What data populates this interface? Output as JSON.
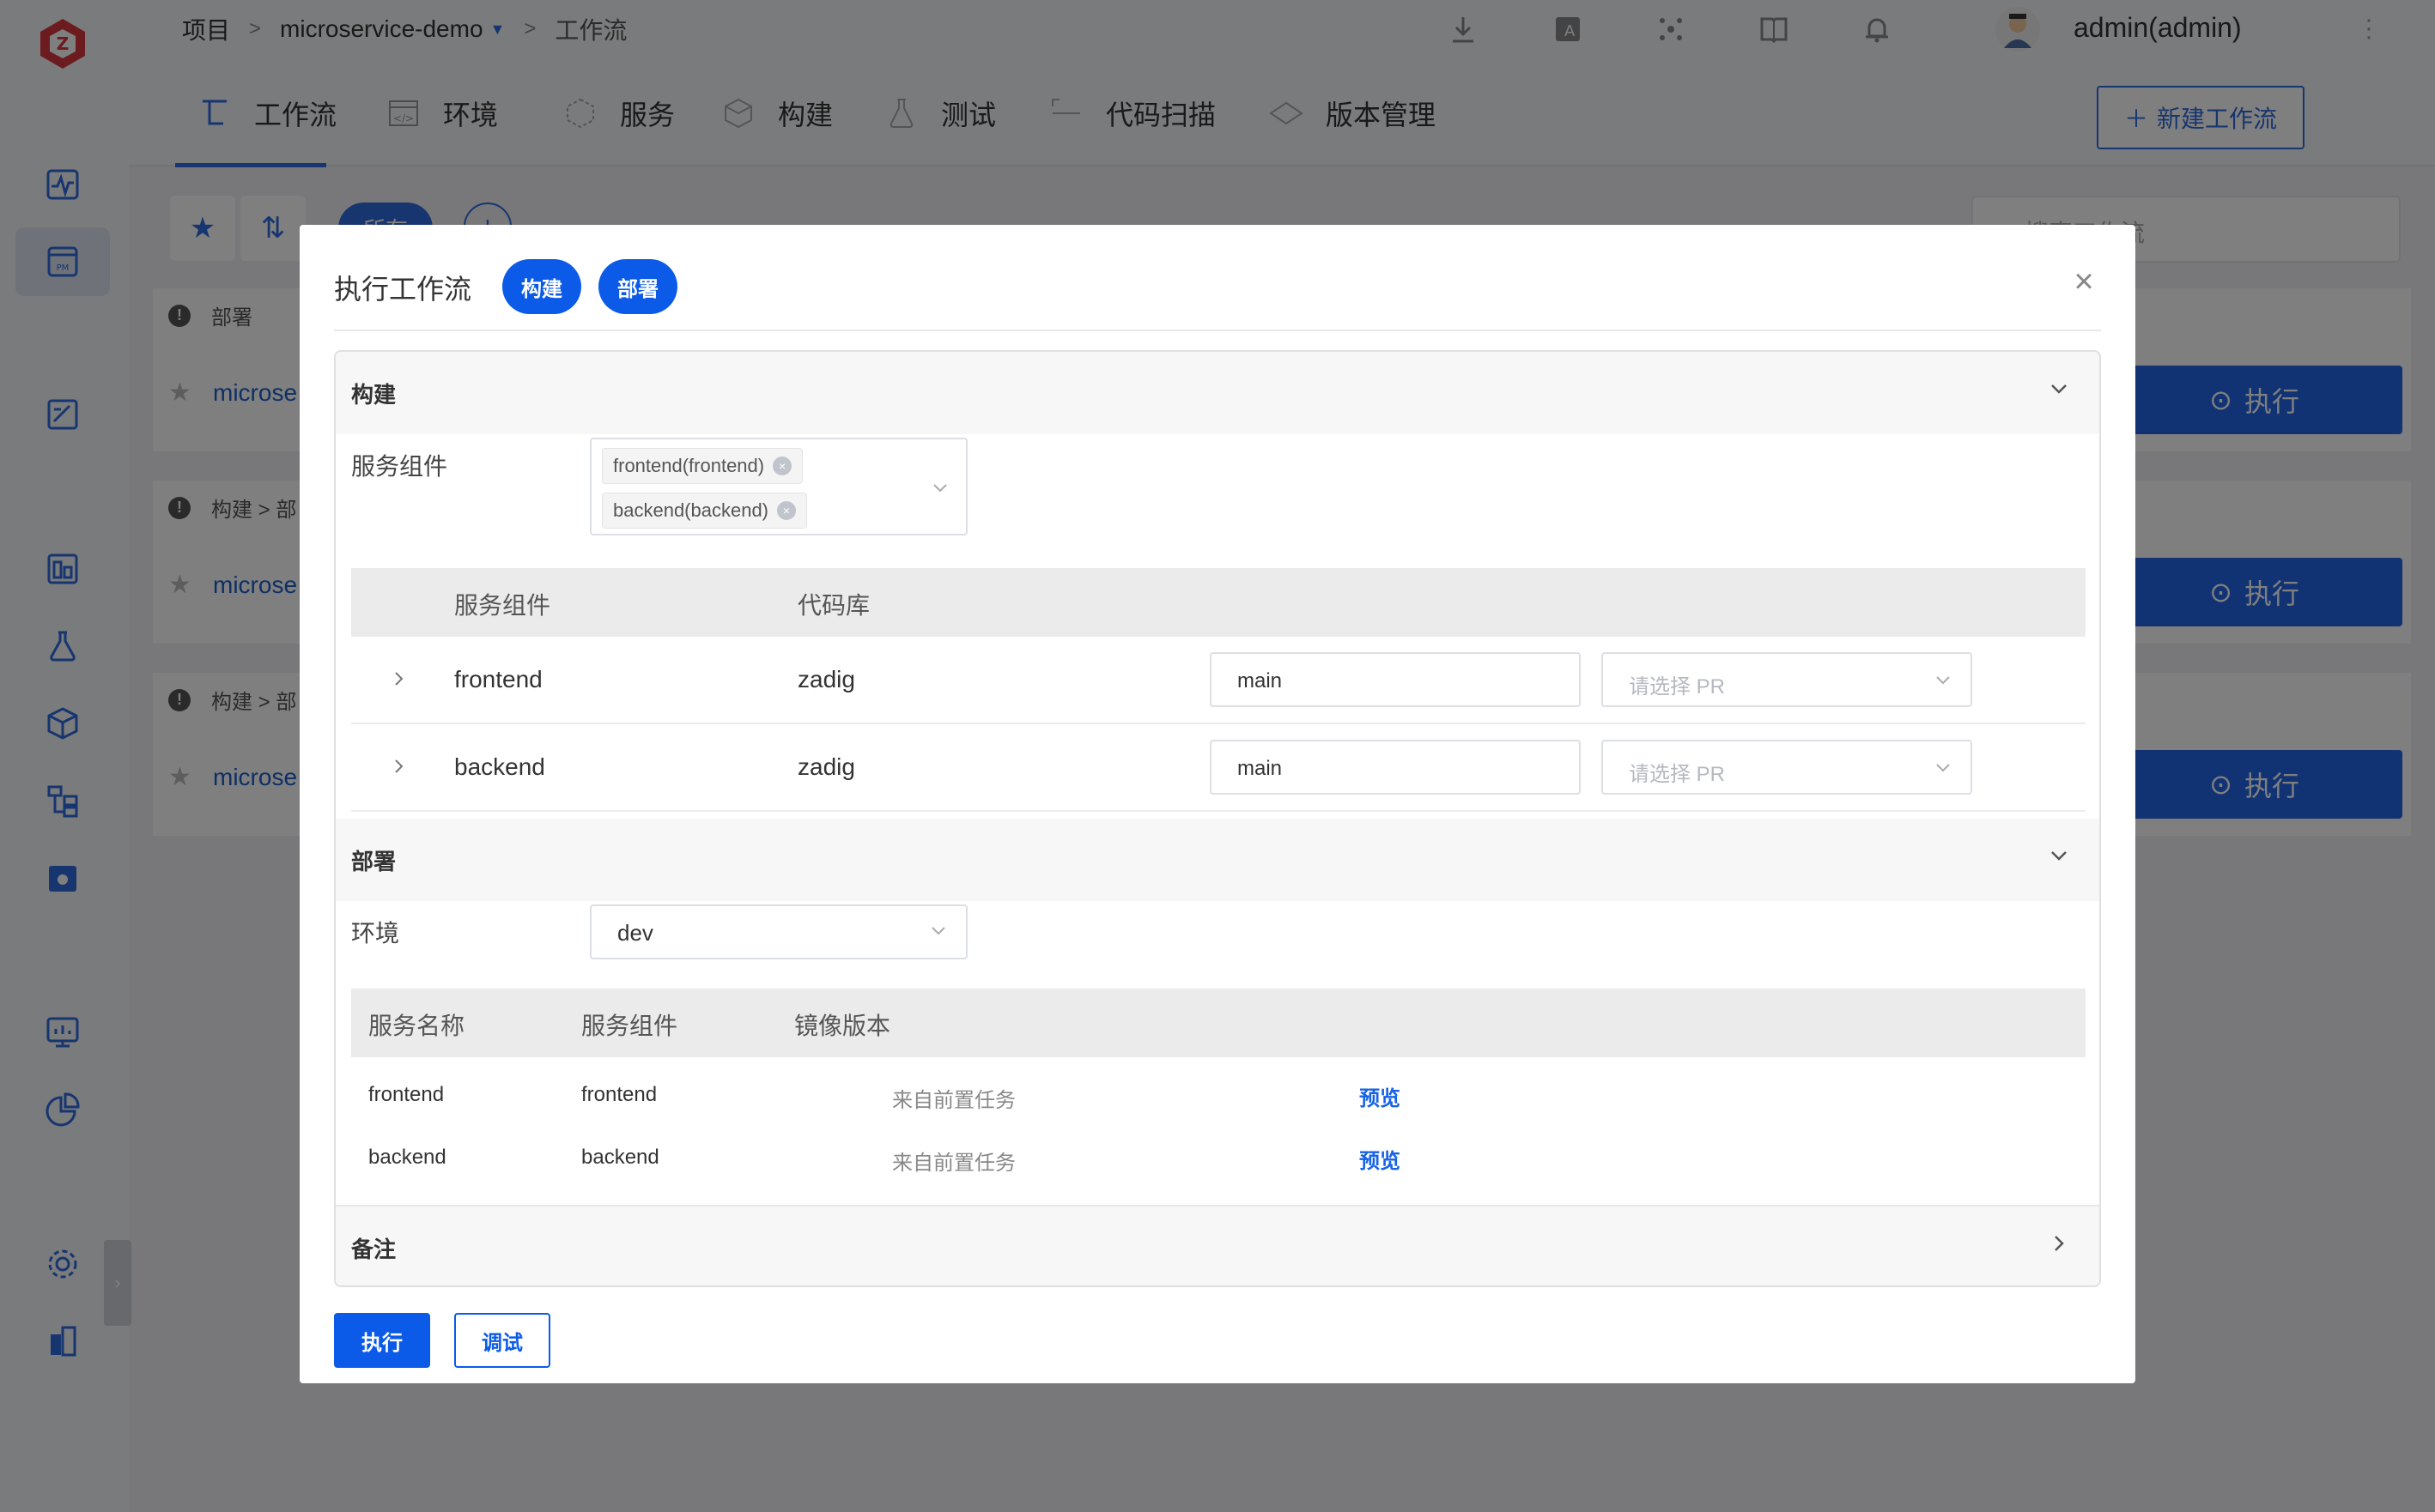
{
  "breadcrumb": {
    "root": "项目",
    "project": "microservice-demo",
    "current": "工作流"
  },
  "user": {
    "name": "admin(admin)"
  },
  "nav": {
    "tabs": [
      {
        "label": "工作流"
      },
      {
        "label": "环境"
      },
      {
        "label": "服务"
      },
      {
        "label": "构建"
      },
      {
        "label": "测试"
      },
      {
        "label": "代码扫描"
      },
      {
        "label": "版本管理"
      }
    ],
    "new_workflow_label": "新建工作流"
  },
  "list": {
    "filter_all": "所有",
    "search_placeholder": "搜索工作流",
    "cards": [
      {
        "stages": "部署",
        "name": "microse",
        "run_label": "执行"
      },
      {
        "stages": "构建  >  部",
        "name": "microse",
        "run_label": "执行"
      },
      {
        "stages": "构建  >  部",
        "name": "microse",
        "run_label": "执行"
      }
    ]
  },
  "modal": {
    "title": "执行工作流",
    "tags": [
      "构建",
      "部署"
    ],
    "build": {
      "title": "构建",
      "service_label": "服务组件",
      "selected": [
        "frontend(frontend)",
        "backend(backend)"
      ],
      "columns": [
        "服务组件",
        "代码库"
      ],
      "rows": [
        {
          "service": "frontend",
          "repo": "zadig",
          "branch": "main",
          "pr_placeholder": "请选择 PR"
        },
        {
          "service": "backend",
          "repo": "zadig",
          "branch": "main",
          "pr_placeholder": "请选择 PR"
        }
      ]
    },
    "deploy": {
      "title": "部署",
      "env_label": "环境",
      "env_value": "dev",
      "columns": [
        "服务名称",
        "服务组件",
        "镜像版本"
      ],
      "rows": [
        {
          "service": "frontend",
          "component": "frontend",
          "image": "来自前置任务",
          "action": "预览"
        },
        {
          "service": "backend",
          "component": "backend",
          "image": "来自前置任务",
          "action": "预览"
        }
      ]
    },
    "remark": {
      "title": "备注"
    },
    "footer": {
      "run_label": "执行",
      "debug_label": "调试"
    }
  },
  "colors": {
    "primary": "#0b5be8",
    "link": "#1763e6",
    "logo": "#d9363e"
  }
}
